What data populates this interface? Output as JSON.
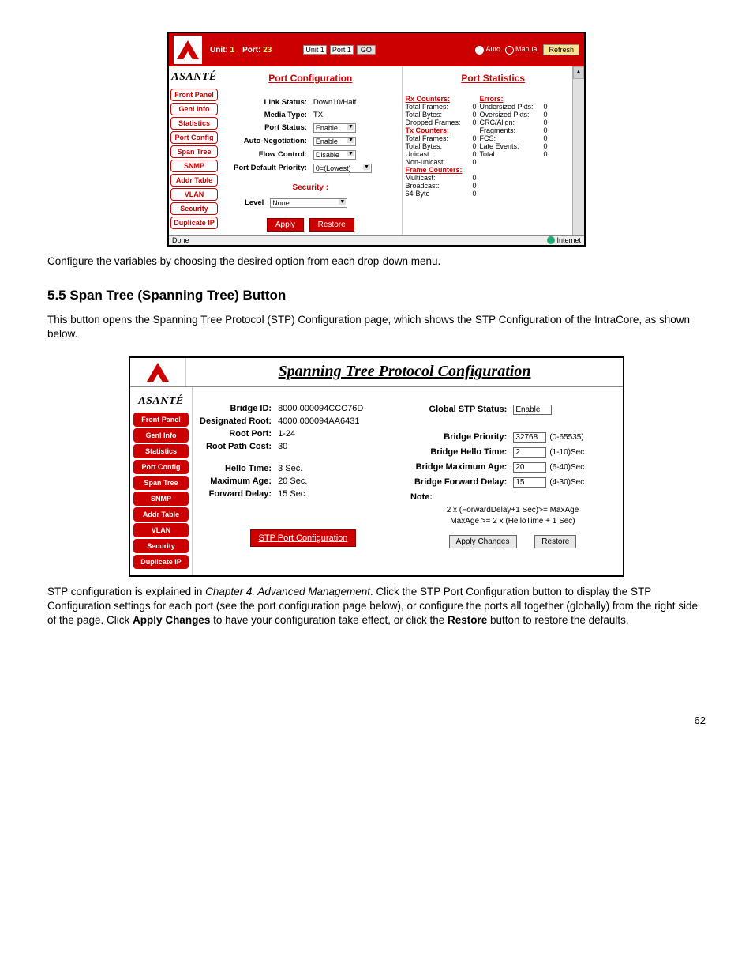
{
  "doc": {
    "caption1": "Configure the variables by choosing the desired option from each drop-down menu.",
    "h2": "5.5 Span Tree (Spanning Tree) Button",
    "p2a": "This button opens the Spanning Tree Protocol (STP) Configuration page, which shows the STP Configuration of the IntraCore, as shown below.",
    "p3_pre": "STP configuration is explained in ",
    "p3_em": "Chapter 4. Advanced Management",
    "p3_post": ". Click the STP Port Configuration button to display the STP Configuration settings for each port (see the port configuration page below), or configure the ports all together (globally) from the right side of the page. Click ",
    "p3_b1": "Apply Changes",
    "p3_mid": " to have your configuration take effect, or click the ",
    "p3_b2": "Restore",
    "p3_end": " button to restore the defaults.",
    "pagenum": "62"
  },
  "brand": "ASANTÉ",
  "nav": {
    "items": [
      "Front Panel",
      "Genl Info",
      "Statistics",
      "Port Config",
      "Span Tree",
      "SNMP",
      "Addr Table",
      "VLAN",
      "Security",
      "Duplicate IP"
    ]
  },
  "s1": {
    "unit_label": "Unit:",
    "unit_val": "1",
    "port_label": "Port:",
    "port_val": "23",
    "dd_unit": "Unit 1",
    "dd_port": "Port 1",
    "go": "GO",
    "auto": "Auto",
    "manual": "Manual",
    "refresh": "Refresh",
    "paneL_title": "Port Configuration",
    "paneR_title": "Port Statistics",
    "form": {
      "link_status_l": "Link Status:",
      "link_status_v": "Down10/Half",
      "media_type_l": "Media Type:",
      "media_type_v": "TX",
      "port_status_l": "Port Status:",
      "port_status_v": "Enable",
      "autoneg_l": "Auto-Negotiation:",
      "autoneg_v": "Enable",
      "flow_l": "Flow Control:",
      "flow_v": "Disable",
      "prio_l": "Port Default Priority:",
      "prio_v": "0=(Lowest)",
      "security_h": "Security :",
      "level_l": "Level",
      "level_v": "None",
      "apply": "Apply",
      "restore": "Restore"
    },
    "stats": {
      "rx_h": "Rx Counters:",
      "err_h": "Errors:",
      "tf_l": "Total Frames:",
      "tf_v": "0",
      "tb_l": "Total Bytes:",
      "tb_v": "0",
      "df_l": "Dropped Frames:",
      "df_v": "0",
      "tx_h": "Tx Counters:",
      "txf_l": "Total Frames:",
      "txf_v": "0",
      "txb_l": "Total Bytes:",
      "txb_v": "0",
      "uc_l": "Unicast:",
      "uc_v": "0",
      "nuc_l": "Non-unicast:",
      "nuc_v": "0",
      "frame_h": "Frame Counters:",
      "mc_l": "Multicast:",
      "mc_v": "0",
      "bc_l": "Broadcast:",
      "bc_v": "0",
      "b64_l": "64-Byte",
      "b64_v": "0",
      "up_l": "Undersized Pkts:",
      "up_v": "0",
      "op_l": "Oversized Pkts:",
      "op_v": "0",
      "crc_l": "CRC/Align:",
      "crc_v": "0",
      "frag_l": "Fragments:",
      "frag_v": "0",
      "fcs_l": "FCS:",
      "fcs_v": "0",
      "le_l": "Late Events:",
      "le_v": "0",
      "tot_l": "Total:",
      "tot_v": "0"
    },
    "status_l": "Done",
    "status_r": "Internet"
  },
  "s2": {
    "title": "Spanning Tree Protocol Configuration",
    "info": {
      "bid_l": "Bridge ID:",
      "bid_v": "8000 000094CCC76D",
      "droot_l": "Designated Root:",
      "droot_v": "4000 000094AA6431",
      "rport_l": "Root Port:",
      "rport_v": "1-24",
      "rcost_l": "Root Path Cost:",
      "rcost_v": "30",
      "hello_l": "Hello Time:",
      "hello_v": "3 Sec.",
      "maxage_l": "Maximum Age:",
      "maxage_v": "20 Sec.",
      "fdelay_l": "Forward Delay:",
      "fdelay_v": "15 Sec."
    },
    "stp_btn": "STP Port Configuration",
    "g": {
      "gstp_l": "Global STP Status:",
      "gstp_v": "Enable",
      "bp_l": "Bridge Priority:",
      "bp_v": "32768",
      "bp_r": "(0-65535)",
      "bh_l": "Bridge Hello Time:",
      "bh_v": "2",
      "bh_r": "(1-10)Sec.",
      "bm_l": "Bridge Maximum Age:",
      "bm_v": "20",
      "bm_r": "(6-40)Sec.",
      "bf_l": "Bridge Forward Delay:",
      "bf_v": "15",
      "bf_r": "(4-30)Sec.",
      "note_l": "Note:",
      "note1": "2 x (ForwardDelay+1 Sec)>= MaxAge",
      "note2": "MaxAge >= 2 x (HelloTime + 1 Sec)",
      "apply": "Apply Changes",
      "restore": "Restore"
    }
  }
}
